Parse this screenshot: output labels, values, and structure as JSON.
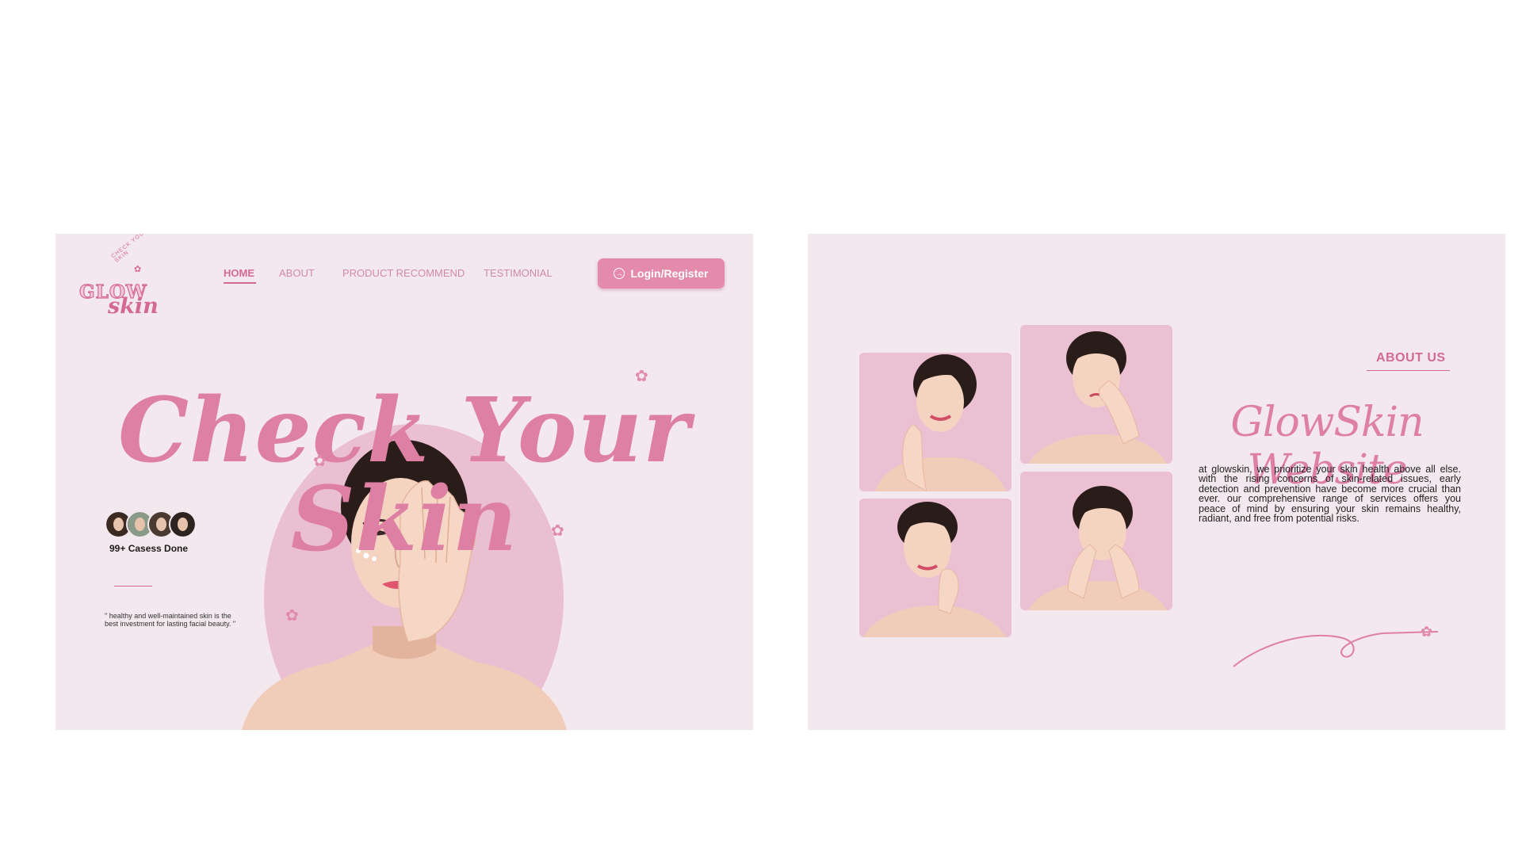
{
  "left_panel": {
    "logo": {
      "text_main": "GLOW",
      "text_script": "skin",
      "text_arc": "CHECK YOUR SKIN"
    },
    "nav": [
      {
        "label": "HOME",
        "active": true
      },
      {
        "label": "ABOUT",
        "active": false
      },
      {
        "label": "PRODUCT RECOMMEND",
        "active": false
      },
      {
        "label": "TESTIMONIAL",
        "active": false
      }
    ],
    "login_button": {
      "label": "Login/Register",
      "icon": "login-icon"
    },
    "hero_title": "Check Your Skin",
    "cases_label": "99+ Casess Done",
    "quote": "\" healthy and well-maintained skin is the best investment for lasting facial beauty. \""
  },
  "right_panel": {
    "about_label": "ABOUT US",
    "brand_title": "GlowSkin Website",
    "about_text": "at glowskin, we prioritize your skin health above all else. with the rising concerns of skin-related issues, early detection and prevention have become more crucial than ever. our comprehensive range of services offers you peace of mind by ensuring your skin remains healthy, radiant, and free from potential risks."
  },
  "colors": {
    "accent": "#de7fa4",
    "accent_dark": "#d46a93",
    "panel_bg": "#f3e8ee",
    "oval_pink": "#ebbfd2",
    "button_bg": "#e48aab"
  }
}
